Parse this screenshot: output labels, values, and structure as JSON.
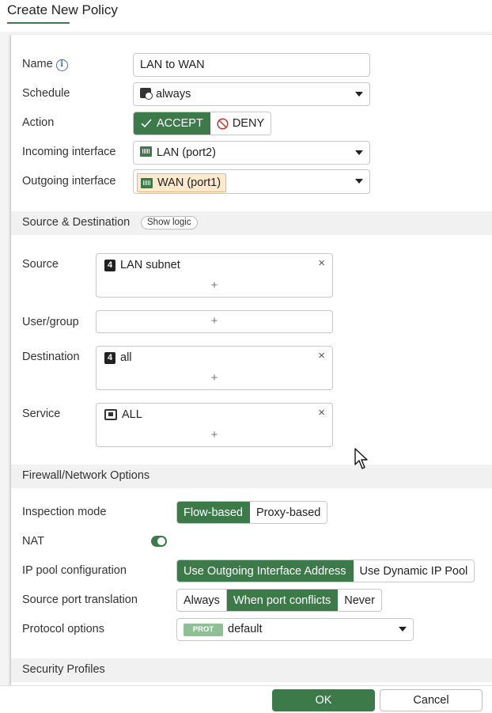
{
  "header": {
    "title": "Create New Policy"
  },
  "form": {
    "name": {
      "label": "Name",
      "value": "LAN to WAN"
    },
    "schedule": {
      "label": "Schedule",
      "value": "always"
    },
    "action": {
      "label": "Action",
      "accept": "ACCEPT",
      "deny": "DENY",
      "selected": "ACCEPT"
    },
    "incoming": {
      "label": "Incoming interface",
      "value": "LAN (port2)"
    },
    "outgoing": {
      "label": "Outgoing interface",
      "value": "WAN (port1)"
    }
  },
  "source_destination": {
    "title": "Source & Destination",
    "show_logic": "Show logic",
    "source": {
      "label": "Source",
      "entry": "LAN subnet"
    },
    "user_group": {
      "label": "User/group"
    },
    "destination": {
      "label": "Destination",
      "entry": "all"
    },
    "service": {
      "label": "Service",
      "entry": "ALL"
    },
    "add_glyph": "+",
    "remove_glyph": "×"
  },
  "firewall": {
    "title": "Firewall/Network Options",
    "inspection": {
      "label": "Inspection mode",
      "options": [
        "Flow-based",
        "Proxy-based"
      ],
      "selected": "Flow-based"
    },
    "nat": {
      "label": "NAT",
      "enabled": true
    },
    "ip_pool": {
      "label": "IP pool configuration",
      "options": [
        "Use Outgoing Interface Address",
        "Use Dynamic IP Pool"
      ],
      "selected": "Use Outgoing Interface Address"
    },
    "source_port": {
      "label": "Source port translation",
      "options": [
        "Always",
        "When port conflicts",
        "Never"
      ],
      "selected": "When port conflicts"
    },
    "protocol": {
      "label": "Protocol options",
      "badge": "PROT",
      "value": "default"
    }
  },
  "security_profiles": {
    "title": "Security Profiles"
  },
  "footer": {
    "ok": "OK",
    "cancel": "Cancel"
  },
  "icons": {
    "name_info": "info-icon",
    "schedule": "schedule-icon",
    "interface": "network-interface-icon",
    "address": "ipv4-address-icon",
    "service": "service-icon"
  },
  "colors": {
    "accent": "#3d7a4a",
    "deny": "#c0392b",
    "wan_highlight": "#fde9cd",
    "info": "#3f6fa8"
  }
}
